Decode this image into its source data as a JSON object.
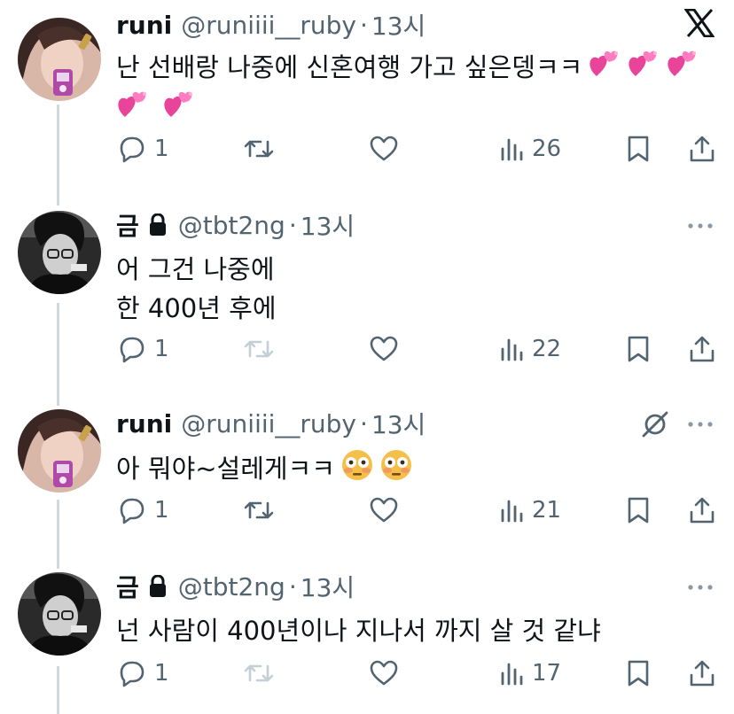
{
  "tweets": [
    {
      "name": "runi",
      "handle": "@runiiii__ruby",
      "separator": "·",
      "time": "13시",
      "locked": false,
      "lines": [
        "난 선배랑 나중에 신혼여행 가고 싶은뎅ㅋㅋ",
        ""
      ],
      "emoji": "two-hearts",
      "reply_count": "1",
      "views": "26",
      "top_icon": "x-logo-icon"
    },
    {
      "name": "금",
      "handle": "@tbt2ng",
      "separator": "·",
      "time": "13시",
      "locked": true,
      "lines": [
        "어 그건 나중에",
        "한 400년 후에"
      ],
      "reply_count": "1",
      "views": "22",
      "top_icon": "more-icon"
    },
    {
      "name": "runi",
      "handle": "@runiiii__ruby",
      "separator": "·",
      "time": "13시",
      "locked": false,
      "lines": [
        "아 뭐야~설레게ㅋㅋ"
      ],
      "emoji": "flushed-face",
      "reply_count": "1",
      "views": "21",
      "top_icon": "more-icon"
    },
    {
      "name": "금",
      "handle": "@tbt2ng",
      "separator": "·",
      "time": "13시",
      "locked": true,
      "lines": [
        "넌 사람이 400년이나 지나서 까지 살 것 같냐"
      ],
      "reply_count": "1",
      "views": "17",
      "top_icon": "more-icon"
    }
  ],
  "colors": {
    "text": "#0f1419",
    "secondary": "#536471",
    "thread_line": "#cfd9de",
    "disabled_retweet": "#c4cfd6",
    "heart_emoji": "#e8459a"
  }
}
